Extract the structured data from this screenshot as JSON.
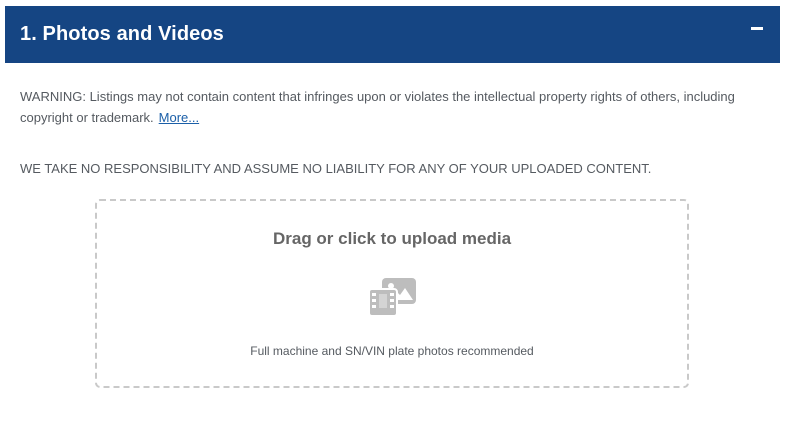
{
  "section": {
    "title": "1. Photos and Videos",
    "toggle_icon": "minus-icon"
  },
  "warning": {
    "text": "WARNING: Listings may not contain content that infringes upon or violates the intellectual property rights of others, including copyright or trademark.",
    "more_link": "More..."
  },
  "liability": {
    "text": "WE TAKE NO RESPONSIBILITY AND ASSUME NO LIABILITY FOR ANY OF YOUR UPLOADED CONTENT."
  },
  "upload": {
    "title": "Drag or click to upload media",
    "icon": "photo-video-icon",
    "hint": "Full machine and SN/VIN plate photos recommended"
  },
  "colors": {
    "header_bg": "#154583",
    "link": "#1b5fa8",
    "icon": "#bdbdbd"
  }
}
